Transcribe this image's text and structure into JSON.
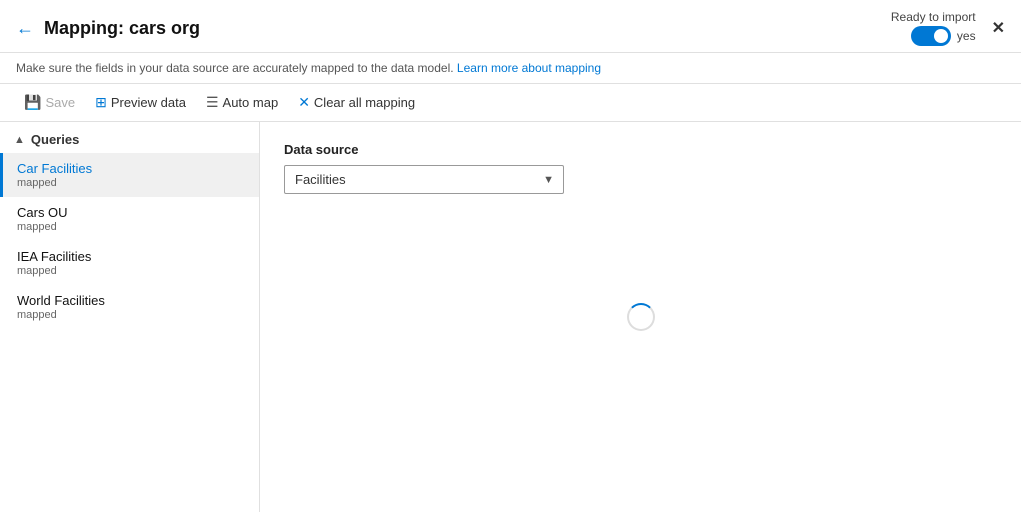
{
  "header": {
    "back_icon": "←",
    "title": "Mapping: cars org",
    "ready_label": "Ready to import",
    "toggle_state": "on",
    "toggle_yes": "yes",
    "close_icon": "✕"
  },
  "subtitle": {
    "text": "Make sure the fields in your data source are accurately mapped to the data model.",
    "link_text": "Learn more about mapping",
    "link_href": "#"
  },
  "toolbar": {
    "save_label": "Save",
    "preview_label": "Preview data",
    "automap_label": "Auto map",
    "clear_label": "Clear all mapping"
  },
  "sidebar": {
    "section_label": "Queries",
    "items": [
      {
        "id": "car-facilities",
        "name": "Car Facilities",
        "status": "mapped",
        "active": true
      },
      {
        "id": "cars-ou",
        "name": "Cars OU",
        "status": "mapped",
        "active": false
      },
      {
        "id": "iea-facilities",
        "name": "IEA Facilities",
        "status": "mapped",
        "active": false
      },
      {
        "id": "world-facilities",
        "name": "World Facilities",
        "status": "mapped",
        "active": false
      }
    ]
  },
  "content": {
    "data_source_label": "Data source",
    "select_options": [
      "Facilities"
    ],
    "select_value": "Facilities",
    "select_placeholder": "Facilities"
  }
}
